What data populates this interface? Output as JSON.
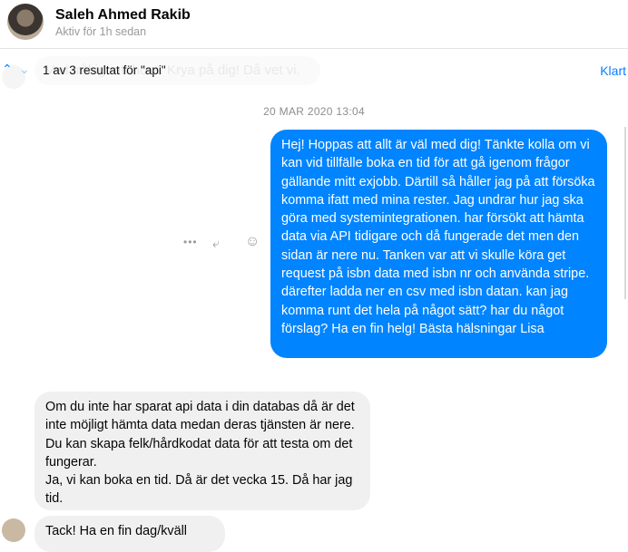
{
  "header": {
    "name": "Saleh Ahmed Rakib",
    "status": "Aktiv för 1h sedan"
  },
  "search": {
    "result": "1 av 3 resultat för \"api\"",
    "done": "Klart",
    "background_message": "Vad tråkigt att höra. Krya på dig!  Då vet vi."
  },
  "conversation": {
    "date": "20 MAR 2020 13:04",
    "messages": [
      {
        "from": "me",
        "text": "Hej! Hoppas att allt är väl med dig! Tänkte kolla om vi kan vid tillfälle boka en tid för att gå igenom frågor gällande mitt exjobb. Därtill så håller jag på att försöka komma ifatt med mina rester. Jag undrar hur jag ska göra med systemintegrationen. har försökt att hämta data via API tidigare och då fungerade det men den sidan är nere nu. Tanken var att vi skulle köra get request  på isbn data med isbn nr och använda stripe. därefter ladda ner en csv med isbn datan. kan jag komma runt det hela på något sätt? har du något förslag? Ha en fin helg! Bästa hälsningar Lisa"
      },
      {
        "from": "them",
        "text": "Om du inte har sparat  api data  i din databas då är det inte möjligt hämta data medan deras tjänsten är nere. Du kan skapa felk/hårdkodat data för att testa om det fungerar.\nJa, vi kan boka en tid. Då är det vecka 15. Då har jag tid."
      },
      {
        "from": "them",
        "text": "Tack! Ha en fin dag/kväll"
      }
    ]
  },
  "colors": {
    "outgoing": "#0084ff",
    "incoming": "#f0f0f0",
    "accent": "#0a7cff"
  }
}
